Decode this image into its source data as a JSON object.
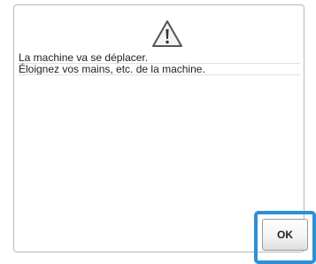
{
  "dialog": {
    "icon": "warning-triangle-icon",
    "message_lines": [
      "La machine va se déplacer.",
      "Éloignez vos mains, etc. de la machine."
    ],
    "ok_label": "OK"
  },
  "colors": {
    "highlight": "#2e8fd6",
    "dialog_border": "#b8b8b8",
    "text": "#222222"
  }
}
